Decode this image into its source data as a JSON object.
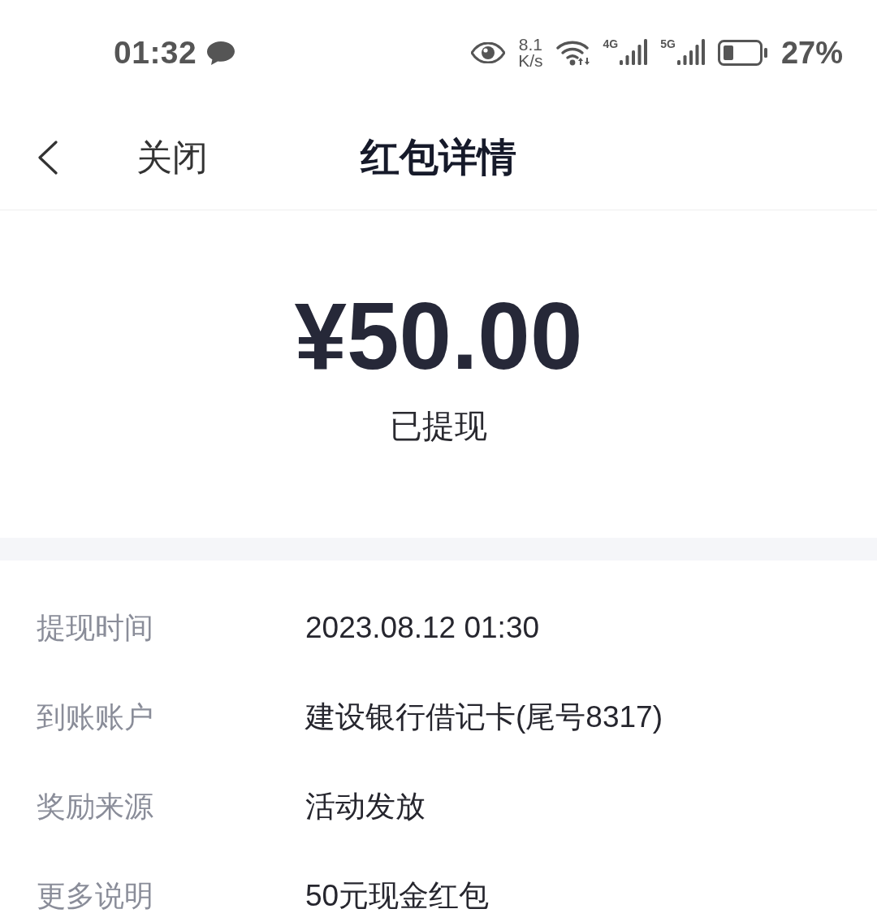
{
  "status_bar": {
    "time": "01:32",
    "speed_value": "8.1",
    "speed_unit": "K/s",
    "networks": [
      "4G",
      "5G"
    ],
    "battery": "27%"
  },
  "nav_bar": {
    "close": "关闭",
    "title": "红包详情"
  },
  "summary": {
    "amount": "¥50.00",
    "status": "已提现"
  },
  "details": [
    {
      "label": "提现时间",
      "value": "2023.08.12 01:30"
    },
    {
      "label": "到账账户",
      "value": "建设银行借记卡(尾号8317)"
    },
    {
      "label": "奖励来源",
      "value": "活动发放"
    },
    {
      "label": "更多说明",
      "value": "50元现金红包"
    }
  ]
}
